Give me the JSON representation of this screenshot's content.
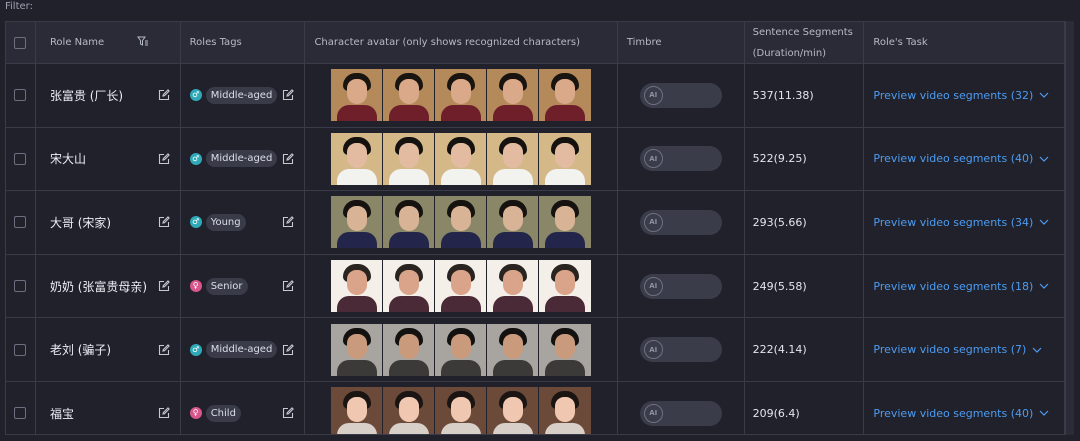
{
  "filter_label": "Filter:",
  "columns": {
    "role_name": "Role Name",
    "roles_tags": "Roles Tags",
    "avatar": "Character avatar (only shows recognized characters)",
    "timbre": "Timbre",
    "segments_line1": "Sentence Segments",
    "segments_line2": "(Duration/min)",
    "task": "Role's Task"
  },
  "rows": [
    {
      "name": "张富贵 (厂长)",
      "tag": "Middle-aged",
      "tag_color": "#2fa9b8",
      "tag_icon": "male-icon",
      "toggle": "AI",
      "segments": "537(11.38)",
      "task": "Preview video segments (32)"
    },
    {
      "name": "宋大山",
      "tag": "Middle-aged",
      "tag_color": "#2fa9b8",
      "tag_icon": "male-icon",
      "toggle": "AI",
      "segments": "522(9.25)",
      "task": "Preview video segments (40)"
    },
    {
      "name": "大哥 (宋家)",
      "tag": "Young",
      "tag_color": "#2fa9b8",
      "tag_icon": "male-icon",
      "toggle": "AI",
      "segments": "293(5.66)",
      "task": "Preview video segments (34)"
    },
    {
      "name": "奶奶 (张富贵母亲)",
      "tag": "Senior",
      "tag_color": "#d8568a",
      "tag_icon": "female-icon",
      "toggle": "AI",
      "segments": "249(5.58)",
      "task": "Preview video segments (18)"
    },
    {
      "name": "老刘 (骗子)",
      "tag": "Middle-aged",
      "tag_color": "#2fa9b8",
      "tag_icon": "male-icon",
      "toggle": "AI",
      "segments": "222(4.14)",
      "task": "Preview video segments (7)"
    },
    {
      "name": "福宝",
      "tag": "Child",
      "tag_color": "#d8568a",
      "tag_icon": "female-icon",
      "toggle": "AI",
      "segments": "209(6.4)",
      "task": "Preview video segments (40)"
    }
  ]
}
